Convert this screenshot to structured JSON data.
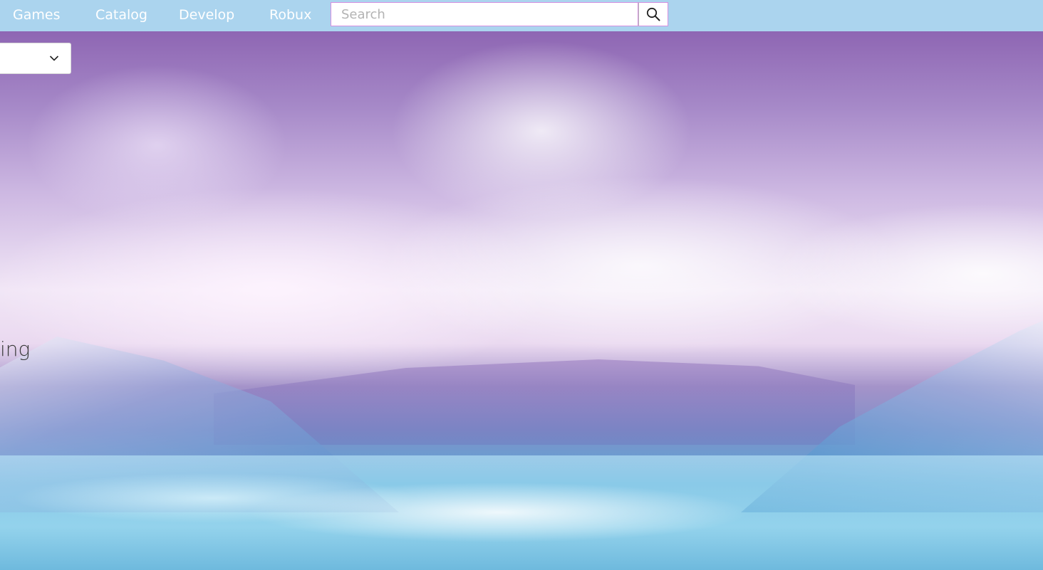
{
  "navbar": {
    "background_color": "#abd4ee",
    "links": [
      {
        "label": "Games"
      },
      {
        "label": "Catalog"
      },
      {
        "label": "Develop"
      },
      {
        "label": "Robux"
      }
    ],
    "search": {
      "placeholder": "Search",
      "value": "",
      "border_color": "#d48fe0",
      "button_icon": "search-icon"
    }
  },
  "dropdown": {
    "icon": "chevron-down-icon"
  },
  "background": {
    "description_icon": "snowy-mountain-landscape"
  },
  "partial_text": "ing"
}
